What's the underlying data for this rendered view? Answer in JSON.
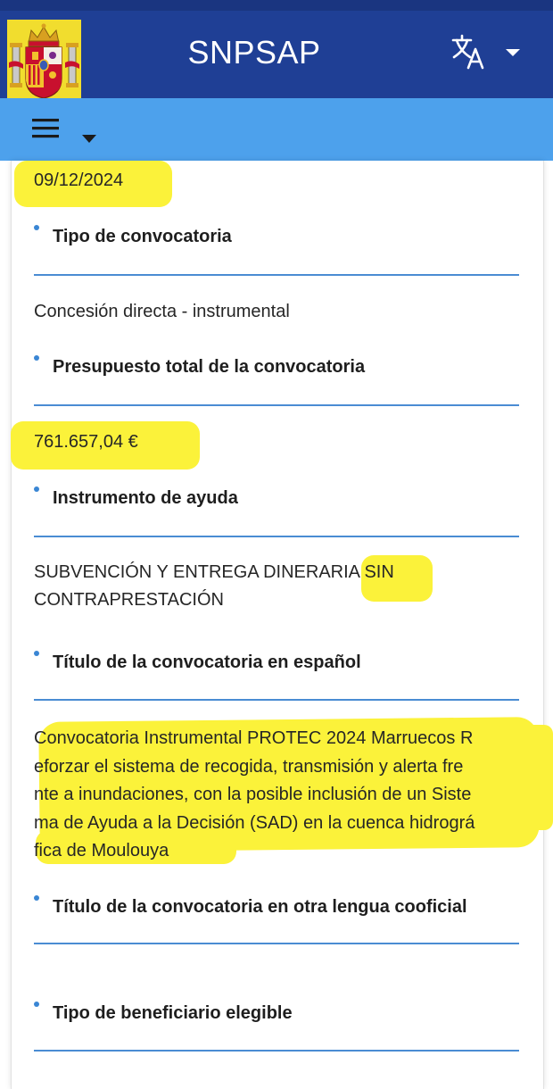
{
  "header": {
    "app_title": "SNPSAP",
    "logo_icon": "spain-coat-of-arms-icon",
    "language_icon": "translate-icon",
    "language_caret_icon": "caret-down-icon",
    "colors": {
      "top_bar": "#1f3f95",
      "nav_bar": "#4da1ec",
      "accent": "#4a8cd3",
      "highlight": "#fbf23a"
    }
  },
  "navbar": {
    "menu_icon": "hamburger-menu-icon",
    "caret_icon": "caret-down-icon"
  },
  "fields": {
    "date_value": "09/12/2024",
    "tipo_convocatoria": {
      "label": "Tipo de convocatoria",
      "value": "Concesión directa - instrumental"
    },
    "presupuesto": {
      "label": "Presupuesto total de la convocatoria",
      "value": "761.657,04 €"
    },
    "instrumento": {
      "label": "Instrumento de ayuda",
      "value": "SUBVENCIÓN Y ENTREGA DINERARIA SIN\nCONTRAPRESTACIÓN"
    },
    "titulo_es": {
      "label": "Título de la convocatoria en español",
      "value": "Convocatoria Instrumental PROTEC 2024 Marruecos R\neforzar el sistema de recogida, transmisión y alerta fre\nnte a inundaciones, con la posible inclusión de un Siste\nma de Ayuda a la Decisión (SAD) en la cuenca hidrográ\nfica de Moulouya"
    },
    "titulo_cooficial": {
      "label": "Título de la convocatoria en otra lengua cooficial"
    },
    "tipo_beneficiario": {
      "label": "Tipo de beneficiario elegible"
    }
  }
}
